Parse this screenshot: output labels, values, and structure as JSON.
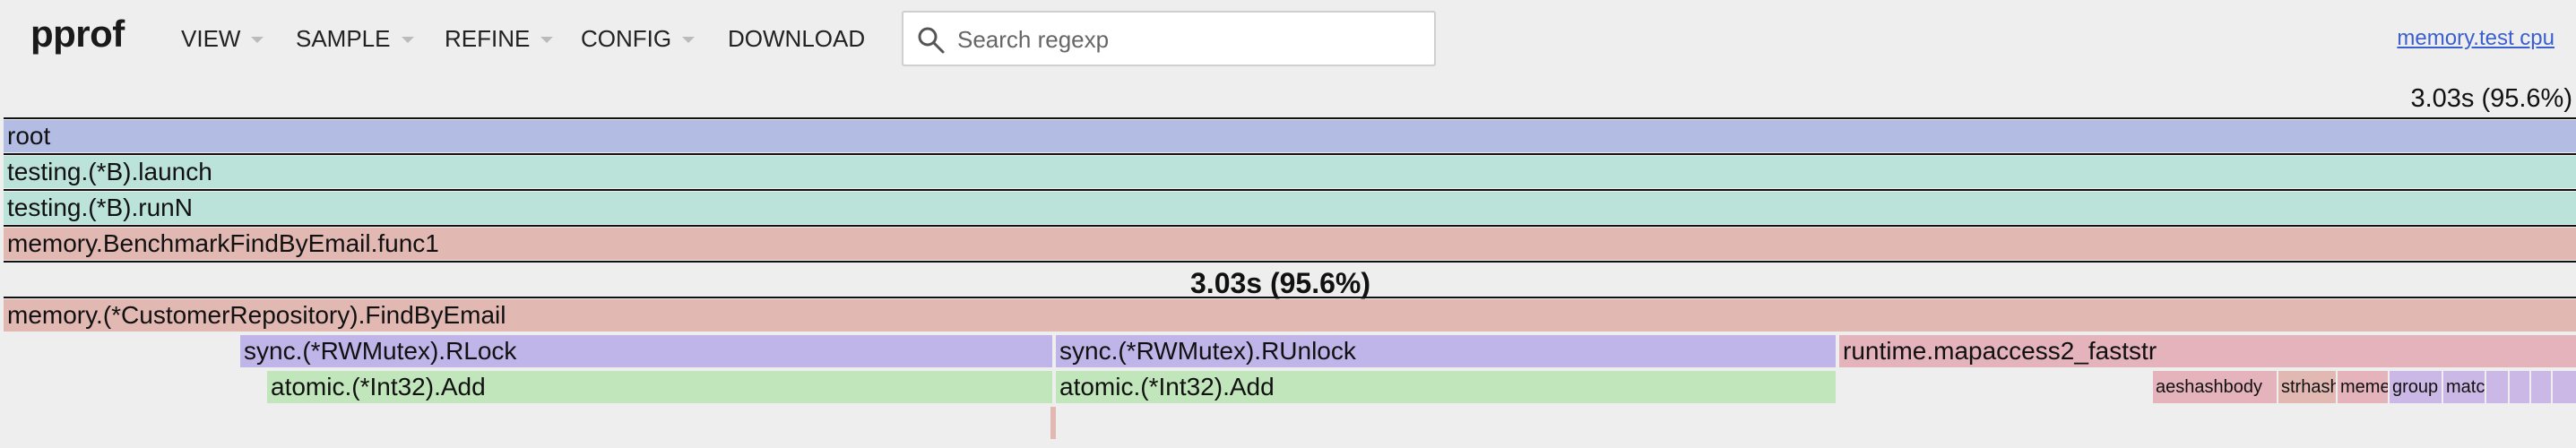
{
  "app": {
    "logo": "pprof"
  },
  "nav": {
    "view": "VIEW",
    "sample": "SAMPLE",
    "refine": "REFINE",
    "config": "CONFIG",
    "download": "DOWNLOAD"
  },
  "search": {
    "placeholder": "Search regexp",
    "value": ""
  },
  "profile_link": "memory.test cpu",
  "total_label": "3.03s (95.6%)",
  "frames": {
    "root": "root",
    "launch": "testing.(*B).launch",
    "runN": "testing.(*B).runN",
    "bench": "memory.BenchmarkFindByEmail.func1",
    "selected_stat": "3.03s (95.6%)",
    "find": "memory.(*CustomerRepository).FindByEmail",
    "rlock": "sync.(*RWMutex).RLock",
    "runlock": "sync.(*RWMutex).RUnlock",
    "mapaccess": "runtime.mapaccess2_faststr",
    "add1": "atomic.(*Int32).Add",
    "add2": "atomic.(*Int32).Add",
    "aeshash": "aeshashbody",
    "strhash": "strhash",
    "memequal": "memequal",
    "group": "group",
    "match": "match"
  },
  "colors": {
    "root": "#b3bde4",
    "testing": "#bce3da",
    "memory": "#e2b8b3",
    "sync": "#c0b5e8",
    "atomic": "#c2e6bb",
    "runtime": "#e4b3bb"
  }
}
